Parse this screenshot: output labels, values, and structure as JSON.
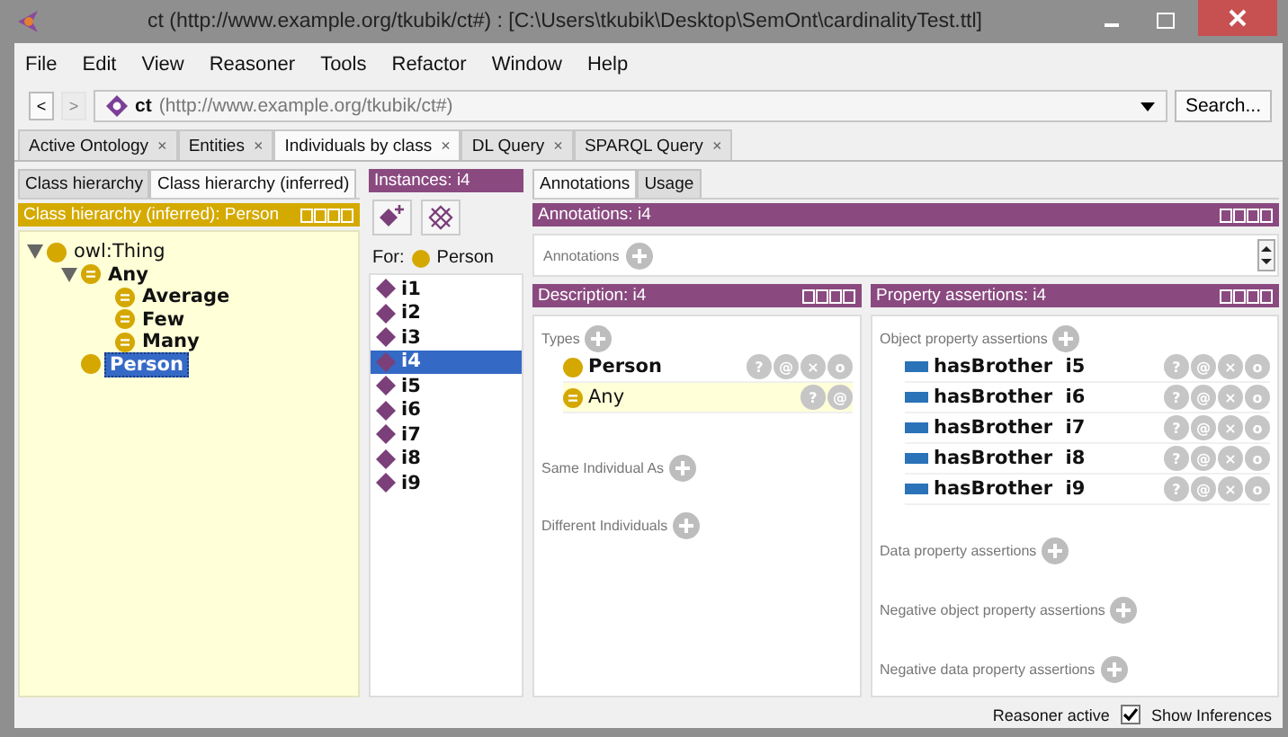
{
  "window": {
    "title": "ct (http://www.example.org/tkubik/ct#)  : [C:\\Users\\tkubik\\Desktop\\SemOnt\\cardinalityTest.ttl]"
  },
  "menu": [
    "File",
    "Edit",
    "View",
    "Reasoner",
    "Tools",
    "Refactor",
    "Window",
    "Help"
  ],
  "address": {
    "back": {
      "label": "<",
      "disabled": false
    },
    "forward": {
      "label": ">",
      "disabled": true
    },
    "name": "ct",
    "iri": "(http://www.example.org/tkubik/ct#)",
    "search_button": "Search..."
  },
  "tabs": [
    {
      "label": "Active Ontology",
      "close": "×",
      "selected": false
    },
    {
      "label": "Entities",
      "close": "×",
      "selected": false
    },
    {
      "label": "Individuals by class",
      "close": "×",
      "selected": true
    },
    {
      "label": "DL Query",
      "close": "×",
      "selected": false
    },
    {
      "label": "SPARQL Query",
      "close": "×",
      "selected": false
    }
  ],
  "class_panel": {
    "tabs": [
      {
        "label": "Class hierarchy",
        "selected": false
      },
      {
        "label": "Class hierarchy (inferred)",
        "selected": true
      }
    ],
    "header": "Class hierarchy (inferred): Person",
    "tree": [
      {
        "label": "owl:Thing",
        "kind": "thing",
        "selected": false,
        "expanded": true,
        "children": [
          {
            "label": "Any",
            "kind": "defined",
            "selected": false,
            "expanded": true,
            "children": [
              {
                "label": "Average",
                "kind": "defined",
                "selected": false
              },
              {
                "label": "Few",
                "kind": "defined",
                "selected": false
              },
              {
                "label": "Many",
                "kind": "defined",
                "selected": false
              }
            ]
          },
          {
            "label": "Person",
            "kind": "class",
            "selected": true
          }
        ]
      }
    ]
  },
  "instances": {
    "header": "Instances: i4",
    "for_label": "For:",
    "for_class": "Person",
    "items": [
      {
        "label": "i1",
        "selected": false
      },
      {
        "label": "i2",
        "selected": false
      },
      {
        "label": "i3",
        "selected": false
      },
      {
        "label": "i4",
        "selected": true
      },
      {
        "label": "i5",
        "selected": false
      },
      {
        "label": "i6",
        "selected": false
      },
      {
        "label": "i7",
        "selected": false
      },
      {
        "label": "i8",
        "selected": false
      },
      {
        "label": "i9",
        "selected": false
      }
    ]
  },
  "right_tabs": [
    {
      "label": "Annotations",
      "selected": true
    },
    {
      "label": "Usage",
      "selected": false
    }
  ],
  "annotations": {
    "header": "Annotations: i4",
    "section": "Annotations"
  },
  "description": {
    "header": "Description: i4",
    "types_label": "Types",
    "types": [
      {
        "label": "Person",
        "kind": "class",
        "inferred": false,
        "buttons": [
          "?",
          "@",
          "×",
          "o"
        ]
      },
      {
        "label": "Any",
        "kind": "defined",
        "inferred": true,
        "buttons": [
          "?",
          "@"
        ]
      }
    ],
    "sections": [
      "Same Individual As",
      "Different Individuals"
    ]
  },
  "property_assertions": {
    "header": "Property assertions: i4",
    "object_label": "Object property assertions",
    "object": [
      {
        "property": "hasBrother",
        "value": "i5",
        "buttons": [
          "?",
          "@",
          "×",
          "o"
        ]
      },
      {
        "property": "hasBrother",
        "value": "i6",
        "buttons": [
          "?",
          "@",
          "×",
          "o"
        ]
      },
      {
        "property": "hasBrother",
        "value": "i7",
        "buttons": [
          "?",
          "@",
          "×",
          "o"
        ]
      },
      {
        "property": "hasBrother",
        "value": "i8",
        "buttons": [
          "?",
          "@",
          "×",
          "o"
        ]
      },
      {
        "property": "hasBrother",
        "value": "i9",
        "buttons": [
          "?",
          "@",
          "×",
          "o"
        ]
      }
    ],
    "sections": [
      "Data property assertions",
      "Negative object property assertions",
      "Negative data property assertions"
    ]
  },
  "status": {
    "text": "Reasoner active",
    "show_inferences": {
      "label": "Show Inferences",
      "checked": true
    }
  }
}
